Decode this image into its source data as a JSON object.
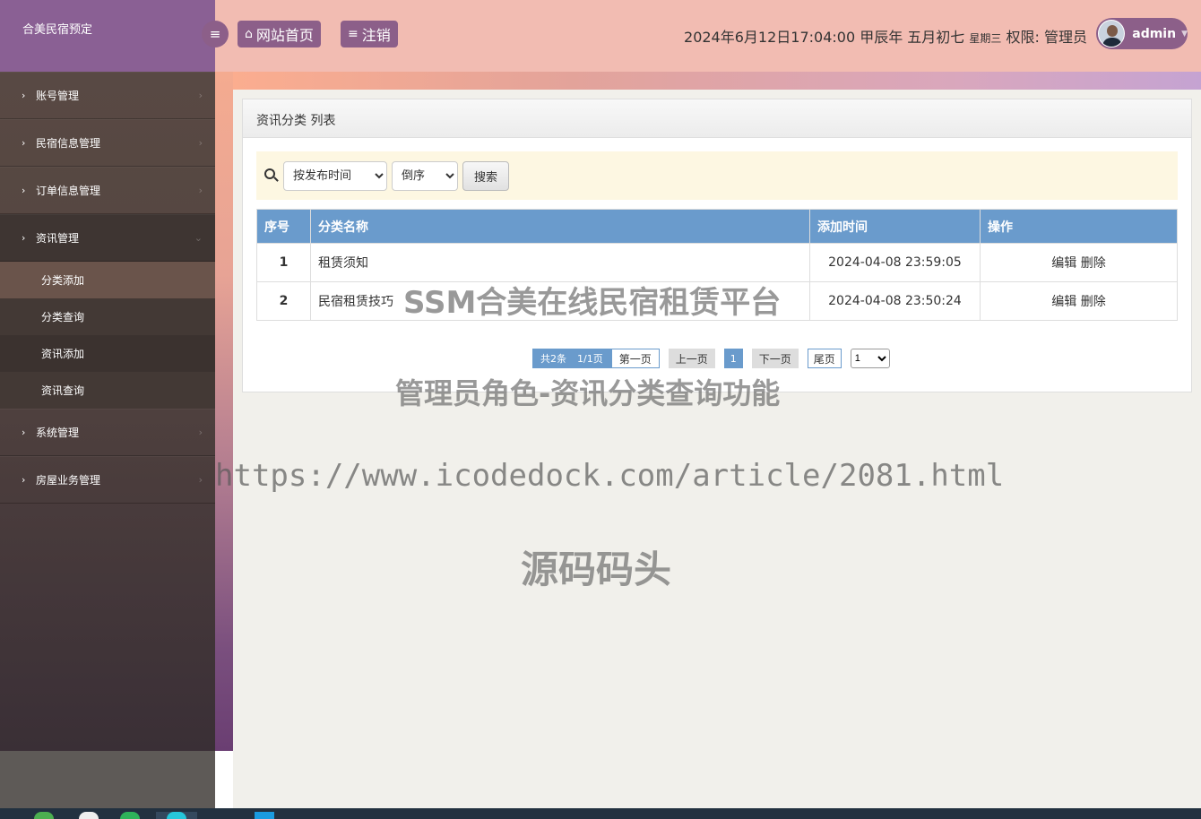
{
  "app": {
    "brand": "合美民宿预定"
  },
  "sidebar": {
    "items": [
      {
        "label": "账号管理"
      },
      {
        "label": "民宿信息管理"
      },
      {
        "label": "订单信息管理"
      },
      {
        "label": "资讯管理",
        "open": true
      },
      {
        "label": "系统管理"
      },
      {
        "label": "房屋业务管理"
      }
    ],
    "submenu": [
      {
        "label": "分类添加"
      },
      {
        "label": "分类查询"
      },
      {
        "label": "资讯添加"
      },
      {
        "label": "资讯查询"
      }
    ]
  },
  "header": {
    "home_label": "网站首页",
    "logout_label": "注销",
    "datetime": "2024年6月12日17:04:00 甲辰年 五月初七 ",
    "weekday": "星期三",
    "permission": "  权限: 管理员",
    "username": "admin"
  },
  "panel": {
    "title": "资讯分类 列表"
  },
  "search": {
    "sort_field": "按发布时间",
    "sort_order": "倒序",
    "button_label": "搜索"
  },
  "table": {
    "headers": [
      "序号",
      "分类名称",
      "添加时间",
      "操作"
    ],
    "rows": [
      {
        "index": "1",
        "name": "租赁须知",
        "time": "2024-04-08 23:59:05",
        "edit": "编辑",
        "delete": "删除"
      },
      {
        "index": "2",
        "name": "民宿租赁技巧",
        "time": "2024-04-08 23:50:24",
        "edit": "编辑",
        "delete": "删除"
      }
    ]
  },
  "pagination": {
    "total": "共2条",
    "pages": "1/1页",
    "first": "第一页",
    "prev": "上一页",
    "current": "1",
    "next": "下一页",
    "last": "尾页",
    "select_value": "1"
  },
  "watermarks": {
    "line1": "SSM合美在线民宿租赁平台",
    "line2": "管理员角色-资讯分类查询功能",
    "line3": "https://www.icodedock.com/article/2081.html",
    "line4": "源码码头"
  },
  "colors": {
    "sidebar_brand": "#8a6094",
    "header_bg": "#f2bcb2",
    "header_button": "#8c5f89",
    "table_header": "#6a9bcc",
    "search_bar": "#fdf7e2"
  }
}
